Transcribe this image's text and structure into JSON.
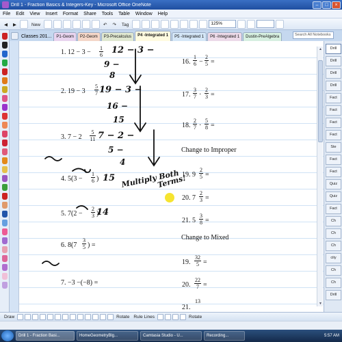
{
  "window": {
    "title": "Drill 1 - Fraction Basics & Integers-Key - Microsoft Office OneNote"
  },
  "menu": [
    "File",
    "Edit",
    "View",
    "Insert",
    "Format",
    "Share",
    "Tools",
    "Table",
    "Window",
    "Help"
  ],
  "toolbar": {
    "new_label": "New",
    "tag_label": "Tag",
    "zoom": "125%"
  },
  "notebook": {
    "name": "Classes 201...",
    "tabs": [
      "P1-Geom",
      "P2-Geom",
      "P3-Precalculus",
      "P4 -Integrated 1",
      "P5 -Integrated 1",
      "P6 -Integrated 1",
      "Dustin-PreAlgebra"
    ],
    "active_tab_index": 3,
    "search_placeholder": "Search All Notebooks"
  },
  "page_list": {
    "items": [
      "Drill",
      "Drill",
      "Drill",
      "Drill",
      "Fact",
      "Fact",
      "Fact",
      "Fact",
      "Ste",
      "Fact",
      "Fact",
      "Quiz",
      "Quiz",
      "Fact",
      "Ch",
      "Ch",
      "Ch",
      "city",
      "Ch",
      "Ch",
      "Drill"
    ],
    "active_index": 0
  },
  "problems": {
    "p1": "1.  12 − 3 −",
    "p1_num": "1",
    "p1_den": "6",
    "p2": "2.  19 − 3",
    "p2_num": "5",
    "p2_den": "7",
    "p3": "3.  7 − 2",
    "p3_num": "5",
    "p3_den": "11",
    "p4": "4.  5(3 −",
    "p4_close": ")",
    "p4_num": "1",
    "p4_den": "6",
    "p5": "5.  7(2 −",
    "p5_close": ")",
    "p5_num": "2",
    "p5_den": "3",
    "p6": "6.  8(7",
    "p6_close": ") =",
    "p6_num": "3",
    "p6_den": "5",
    "p7": "7.   −3 −(−8) =",
    "p16": "16.",
    "p16_a_num": "1",
    "p16_a_den": "6",
    "p16_b_num": "2",
    "p16_b_den": "5",
    "p17": "17.",
    "p17_a_num": "3",
    "p17_a_den": "7",
    "p17_b_num": "2",
    "p17_b_den": "3",
    "p18": "18.",
    "p18_a_num": "2",
    "p18_a_den": "7",
    "p18_b_num": "5",
    "p18_b_den": "8",
    "heading_improper": "Change to Improper",
    "p19": "19.   9",
    "p19_num": "2",
    "p19_den": "5",
    "p20": "20.   7",
    "p20_num": "2",
    "p20_den": "3",
    "p21": "21.   5",
    "p21_num": "3",
    "p21_den": "8",
    "heading_mixed": "Change to Mixed",
    "p19m": "19.",
    "p19m_num": "32",
    "p19m_den": "5",
    "p20m": "20.",
    "p20m_num": "22",
    "p20m_den": "7",
    "p21m": "21.",
    "p21m_num": "13"
  },
  "handwriting": {
    "p1_work_1": "12 − 3 −",
    "p1_work_2": "9 −",
    "p1_work_3": "8",
    "p2_work_1": "19 − 3 −",
    "p2_work_2": "16 −",
    "p2_work_3": "15",
    "p3_work_1": "7 − 2 −",
    "p3_work_2": "5 −",
    "p3_work_3": "4",
    "p4_work": "15",
    "p4_note": "Multiply Both",
    "p4_note_2": "Terms!",
    "p5_work": "14"
  },
  "drawbar": {
    "draw_label": "Draw",
    "rotate_label": "Rotate",
    "rule_lines_label": "Rule Lines"
  },
  "taskbar": {
    "tasks": [
      "Drill 1 - Fraction Basi...",
      "HomeGeometryBlg...",
      "Camtasia Studio - U...",
      "Recording..."
    ],
    "active_index": 0,
    "clock": "5:57 AM"
  },
  "colors": {
    "highlight_marker": "#f5e11a",
    "active_tab": "#fffbe0",
    "pen_colors": [
      "#cc2222",
      "#222222",
      "#2266cc",
      "#22aa44",
      "#cc2222",
      "#e07b1a",
      "#ccaa22",
      "#dd5588",
      "#9933cc",
      "#dd3333",
      "#ee8855",
      "#dd4466",
      "#cc2233",
      "#e05a7a",
      "#e38a1c",
      "#e6c04b",
      "#9a55c0",
      "#3a9e3a",
      "#cc2222",
      "#e09a6a",
      "#2255aa",
      "#66a0e0",
      "#ed5c95",
      "#a06bd0",
      "#e8a0b0",
      "#dd6699",
      "#b06ecf",
      "#f0c0d8",
      "#c0a0e0"
    ]
  }
}
